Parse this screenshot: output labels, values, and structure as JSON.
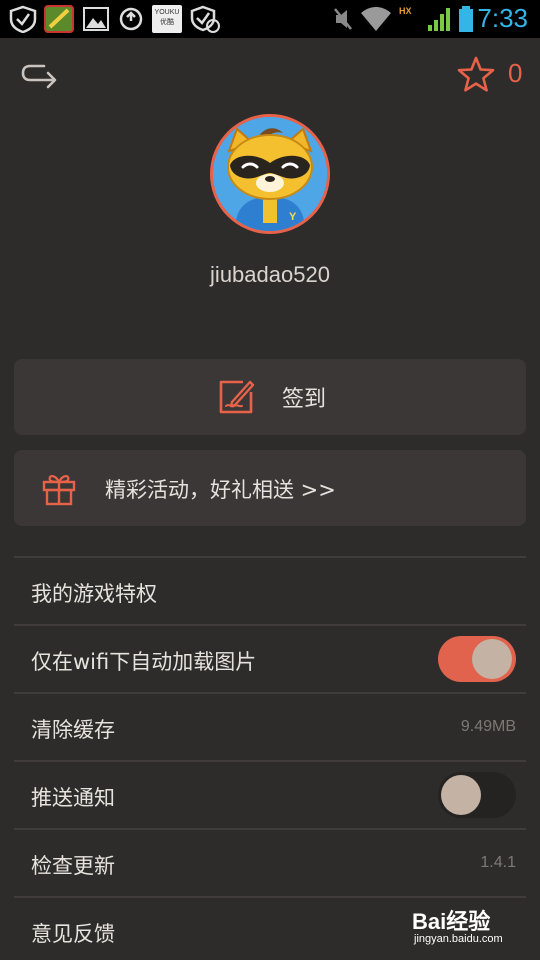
{
  "status_bar": {
    "time": "7:33",
    "app_badge": "YOUKU\n优酷",
    "icons": [
      "shield-icon",
      "game-app-icon",
      "image-icon",
      "sync-icon",
      "youku-icon",
      "shield-check-icon",
      "mute-icon",
      "wifi-icon",
      "signal-icon",
      "battery-icon"
    ]
  },
  "header": {
    "back_icon": "back-arrow-icon",
    "star_icon": "star-icon",
    "star_count": "0"
  },
  "profile": {
    "username": "jiubadao520"
  },
  "checkin": {
    "label": "签到",
    "icon": "edit-icon"
  },
  "activity": {
    "label": "精彩活动，好礼相送 >>",
    "icon": "gift-icon"
  },
  "settings": {
    "items": [
      {
        "label": "我的游戏特权"
      },
      {
        "label": "仅在wifi下自动加载图片",
        "toggle": "on"
      },
      {
        "label": "清除缓存",
        "value": "9.49MB"
      },
      {
        "label": "推送通知",
        "toggle": "off"
      },
      {
        "label": "检查更新",
        "value": "1.4.1"
      },
      {
        "label": "意见反馈"
      }
    ]
  },
  "watermark": {
    "brand": "Bai经验",
    "url": "jingyan.baidu.com"
  },
  "colors": {
    "accent": "#e8624a",
    "background": "#2e2c2b",
    "card": "#3a3736",
    "status_time": "#33b5e5"
  }
}
